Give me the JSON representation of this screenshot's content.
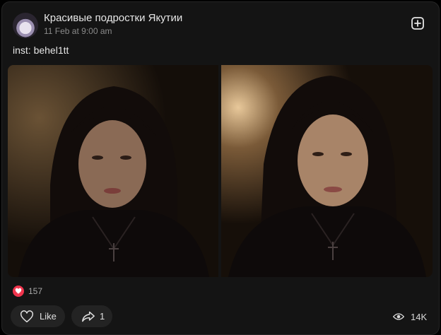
{
  "post": {
    "channel_name": "Красивые подростки Якутии",
    "date": "11 Feb at 9:00 am",
    "text": "inst: behel1tt"
  },
  "reactions": {
    "likes_count": "157",
    "like_label": "Like",
    "shares_count": "1",
    "views_count": "14K"
  },
  "icons": {
    "add": "plus-square-icon",
    "reaction": "heart-icon",
    "like": "heart-outline-icon",
    "share": "share-arrow-icon",
    "views": "eye-icon"
  },
  "colors": {
    "background": "#141414",
    "pill": "#232323",
    "heart_badge": "#f0354d",
    "primary_text": "#e6e6e6",
    "secondary_text": "#8a8a8a"
  }
}
